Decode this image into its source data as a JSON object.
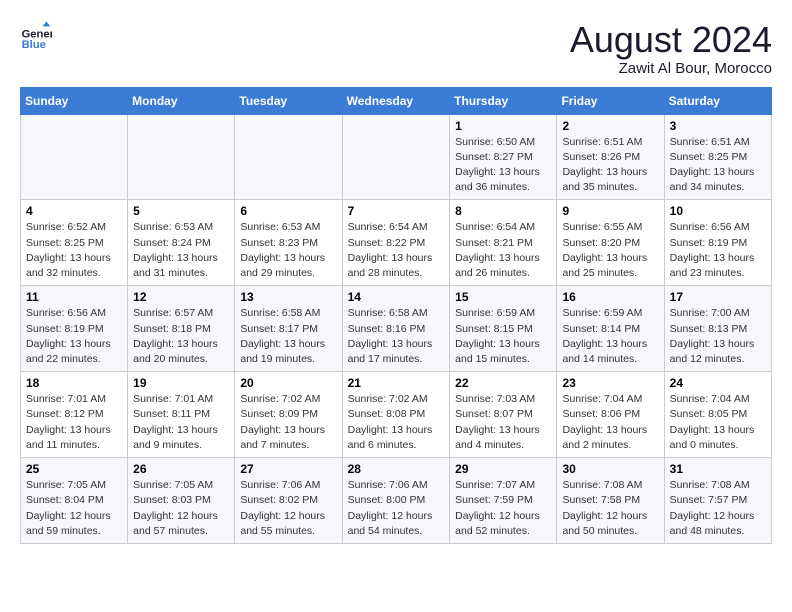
{
  "header": {
    "logo_line1": "General",
    "logo_line2": "Blue",
    "month": "August 2024",
    "location": "Zawit Al Bour, Morocco"
  },
  "weekdays": [
    "Sunday",
    "Monday",
    "Tuesday",
    "Wednesday",
    "Thursday",
    "Friday",
    "Saturday"
  ],
  "weeks": [
    [
      {
        "day": "",
        "info": ""
      },
      {
        "day": "",
        "info": ""
      },
      {
        "day": "",
        "info": ""
      },
      {
        "day": "",
        "info": ""
      },
      {
        "day": "1",
        "info": "Sunrise: 6:50 AM\nSunset: 8:27 PM\nDaylight: 13 hours and 36 minutes."
      },
      {
        "day": "2",
        "info": "Sunrise: 6:51 AM\nSunset: 8:26 PM\nDaylight: 13 hours and 35 minutes."
      },
      {
        "day": "3",
        "info": "Sunrise: 6:51 AM\nSunset: 8:25 PM\nDaylight: 13 hours and 34 minutes."
      }
    ],
    [
      {
        "day": "4",
        "info": "Sunrise: 6:52 AM\nSunset: 8:25 PM\nDaylight: 13 hours and 32 minutes."
      },
      {
        "day": "5",
        "info": "Sunrise: 6:53 AM\nSunset: 8:24 PM\nDaylight: 13 hours and 31 minutes."
      },
      {
        "day": "6",
        "info": "Sunrise: 6:53 AM\nSunset: 8:23 PM\nDaylight: 13 hours and 29 minutes."
      },
      {
        "day": "7",
        "info": "Sunrise: 6:54 AM\nSunset: 8:22 PM\nDaylight: 13 hours and 28 minutes."
      },
      {
        "day": "8",
        "info": "Sunrise: 6:54 AM\nSunset: 8:21 PM\nDaylight: 13 hours and 26 minutes."
      },
      {
        "day": "9",
        "info": "Sunrise: 6:55 AM\nSunset: 8:20 PM\nDaylight: 13 hours and 25 minutes."
      },
      {
        "day": "10",
        "info": "Sunrise: 6:56 AM\nSunset: 8:19 PM\nDaylight: 13 hours and 23 minutes."
      }
    ],
    [
      {
        "day": "11",
        "info": "Sunrise: 6:56 AM\nSunset: 8:19 PM\nDaylight: 13 hours and 22 minutes."
      },
      {
        "day": "12",
        "info": "Sunrise: 6:57 AM\nSunset: 8:18 PM\nDaylight: 13 hours and 20 minutes."
      },
      {
        "day": "13",
        "info": "Sunrise: 6:58 AM\nSunset: 8:17 PM\nDaylight: 13 hours and 19 minutes."
      },
      {
        "day": "14",
        "info": "Sunrise: 6:58 AM\nSunset: 8:16 PM\nDaylight: 13 hours and 17 minutes."
      },
      {
        "day": "15",
        "info": "Sunrise: 6:59 AM\nSunset: 8:15 PM\nDaylight: 13 hours and 15 minutes."
      },
      {
        "day": "16",
        "info": "Sunrise: 6:59 AM\nSunset: 8:14 PM\nDaylight: 13 hours and 14 minutes."
      },
      {
        "day": "17",
        "info": "Sunrise: 7:00 AM\nSunset: 8:13 PM\nDaylight: 13 hours and 12 minutes."
      }
    ],
    [
      {
        "day": "18",
        "info": "Sunrise: 7:01 AM\nSunset: 8:12 PM\nDaylight: 13 hours and 11 minutes."
      },
      {
        "day": "19",
        "info": "Sunrise: 7:01 AM\nSunset: 8:11 PM\nDaylight: 13 hours and 9 minutes."
      },
      {
        "day": "20",
        "info": "Sunrise: 7:02 AM\nSunset: 8:09 PM\nDaylight: 13 hours and 7 minutes."
      },
      {
        "day": "21",
        "info": "Sunrise: 7:02 AM\nSunset: 8:08 PM\nDaylight: 13 hours and 6 minutes."
      },
      {
        "day": "22",
        "info": "Sunrise: 7:03 AM\nSunset: 8:07 PM\nDaylight: 13 hours and 4 minutes."
      },
      {
        "day": "23",
        "info": "Sunrise: 7:04 AM\nSunset: 8:06 PM\nDaylight: 13 hours and 2 minutes."
      },
      {
        "day": "24",
        "info": "Sunrise: 7:04 AM\nSunset: 8:05 PM\nDaylight: 13 hours and 0 minutes."
      }
    ],
    [
      {
        "day": "25",
        "info": "Sunrise: 7:05 AM\nSunset: 8:04 PM\nDaylight: 12 hours and 59 minutes."
      },
      {
        "day": "26",
        "info": "Sunrise: 7:05 AM\nSunset: 8:03 PM\nDaylight: 12 hours and 57 minutes."
      },
      {
        "day": "27",
        "info": "Sunrise: 7:06 AM\nSunset: 8:02 PM\nDaylight: 12 hours and 55 minutes."
      },
      {
        "day": "28",
        "info": "Sunrise: 7:06 AM\nSunset: 8:00 PM\nDaylight: 12 hours and 54 minutes."
      },
      {
        "day": "29",
        "info": "Sunrise: 7:07 AM\nSunset: 7:59 PM\nDaylight: 12 hours and 52 minutes."
      },
      {
        "day": "30",
        "info": "Sunrise: 7:08 AM\nSunset: 7:58 PM\nDaylight: 12 hours and 50 minutes."
      },
      {
        "day": "31",
        "info": "Sunrise: 7:08 AM\nSunset: 7:57 PM\nDaylight: 12 hours and 48 minutes."
      }
    ]
  ]
}
